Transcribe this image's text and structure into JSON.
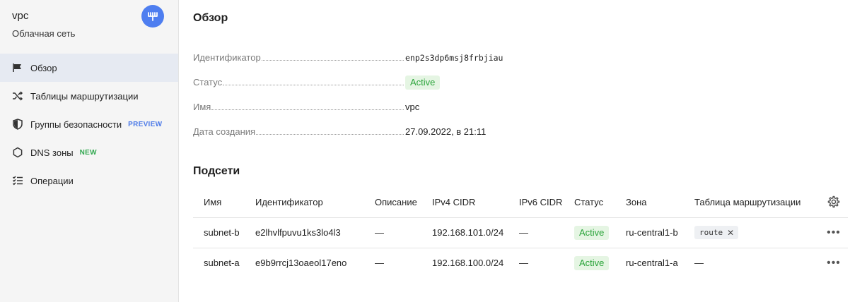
{
  "sidebar": {
    "title": "vpc",
    "subtitle": "Облачная сеть",
    "logo_icon": "vpc-network-icon",
    "items": [
      {
        "label": "Обзор",
        "icon": "flag-icon",
        "active": true
      },
      {
        "label": "Таблицы маршрутизации",
        "icon": "shuffle-icon"
      },
      {
        "label": "Группы безопасности",
        "icon": "shield-icon",
        "badge": "PREVIEW"
      },
      {
        "label": "DNS зоны",
        "icon": "hexagon-icon",
        "badge": "NEW"
      },
      {
        "label": "Операции",
        "icon": "checklist-icon"
      }
    ]
  },
  "overview": {
    "title": "Обзор",
    "id_label": "Идентификатор",
    "id_value": "enp2s3dp6msj8frbjiau",
    "status_label": "Статус",
    "status_value": "Active",
    "name_label": "Имя",
    "name_value": "vpc",
    "created_label": "Дата создания",
    "created_value": "27.09.2022, в 21:11"
  },
  "subnets": {
    "title": "Подсети",
    "columns": [
      "Имя",
      "Идентификатор",
      "Описание",
      "IPv4 CIDR",
      "IPv6 CIDR",
      "Статус",
      "Зона",
      "Таблица маршрутизации"
    ],
    "rows": [
      {
        "name": "subnet-b",
        "id": "e2lhvlfpuvu1ks3lo4l3",
        "description": "—",
        "ipv4": "192.168.101.0/24",
        "ipv6": "—",
        "status": "Active",
        "zone": "ru-central1-b",
        "route_table": "route"
      },
      {
        "name": "subnet-a",
        "id": "e9b9rrcj13oaeol17eno",
        "description": "—",
        "ipv4": "192.168.100.0/24",
        "ipv6": "—",
        "status": "Active",
        "zone": "ru-central1-a",
        "route_table": "—"
      }
    ]
  },
  "colors": {
    "accent": "#4e7ef0",
    "active_bg": "#e5f5e3",
    "active_text": "#2aa43a",
    "preview": "#4f7ce8",
    "new": "#32a850"
  }
}
